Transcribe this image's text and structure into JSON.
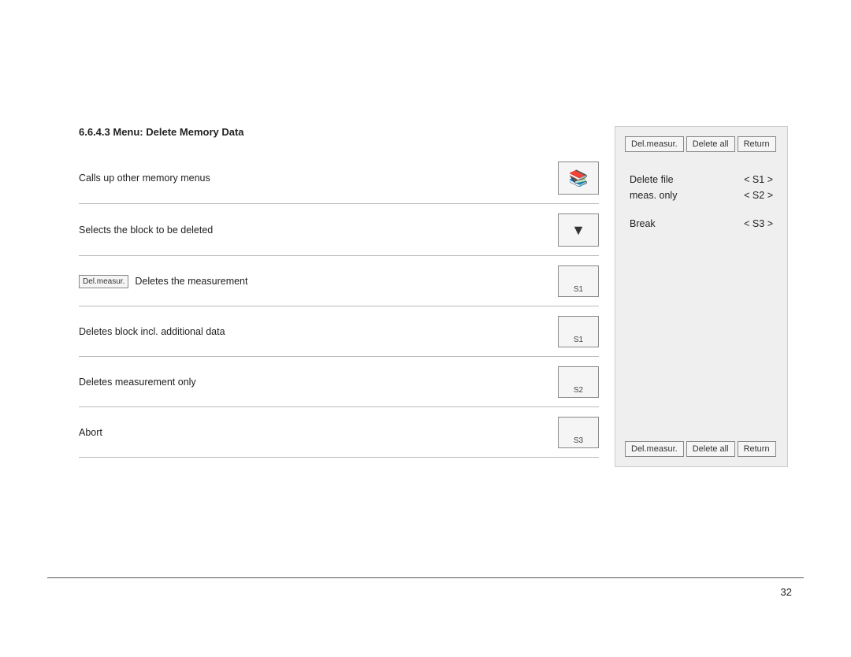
{
  "section_title": "6.6.4.3  Menu: Delete Memory Data",
  "rows": [
    {
      "id": "row-memory-menus",
      "label": "Calls up other memory menus",
      "button_type": "book",
      "button_label": ""
    },
    {
      "id": "row-select-block",
      "label": "Selects the block to be deleted",
      "button_type": "arrow",
      "button_label": ""
    },
    {
      "id": "row-del-measur",
      "label": "Deletes the measurement",
      "button_type": "labeled",
      "button_label": "S1",
      "badge": "Del.measur."
    },
    {
      "id": "row-del-block",
      "label": "Deletes block incl. additional data",
      "button_type": "labeled",
      "button_label": "S1",
      "badge": ""
    },
    {
      "id": "row-del-meas-only",
      "label": "Deletes measurement only",
      "button_type": "labeled",
      "button_label": "S2",
      "badge": ""
    },
    {
      "id": "row-abort",
      "label": "Abort",
      "button_type": "labeled",
      "button_label": "S3",
      "badge": ""
    }
  ],
  "right_panel": {
    "top_buttons": [
      "Del.measur.",
      "Delete all",
      "Return"
    ],
    "menu_items": [
      {
        "label": "Delete file",
        "key": "< S1 >"
      },
      {
        "label": "meas. only",
        "key": "< S2 >"
      },
      {
        "label": "Break",
        "key": "< S3 >"
      }
    ],
    "bottom_buttons": [
      "Del.measur.",
      "Delete all",
      "Return"
    ]
  },
  "page_number": "32"
}
